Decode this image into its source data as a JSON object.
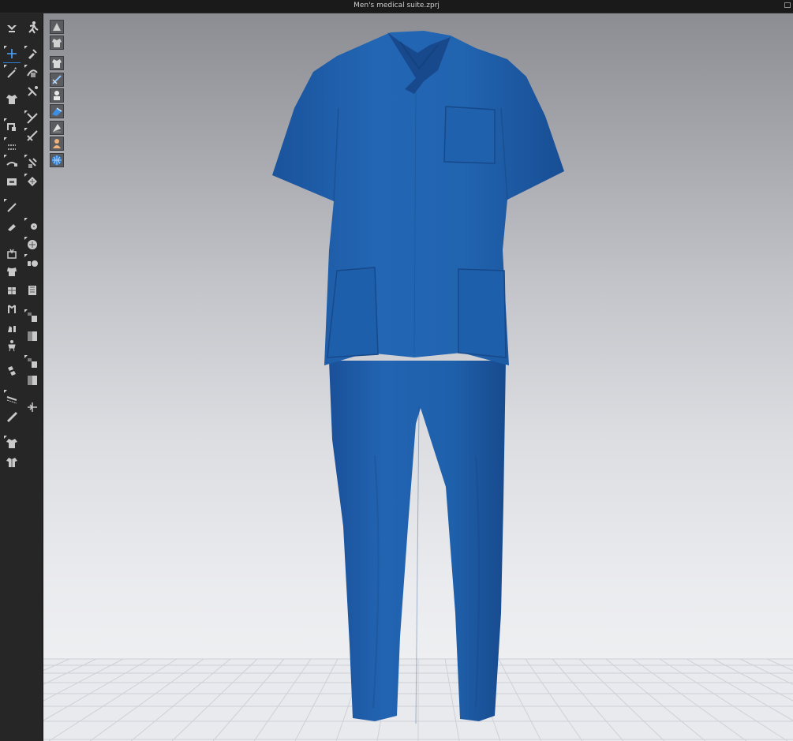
{
  "window": {
    "title": "Men's medical suite.zprj"
  },
  "colors": {
    "garment_blue": "#1d5eaa",
    "floor_grid": "#d7d8de",
    "toolbar_bg": "#262626"
  },
  "toolbar": {
    "tools": [
      {
        "name": "select-move-icon"
      },
      {
        "name": "simulation-icon"
      },
      {
        "name": "transform-pattern-icon"
      },
      {
        "name": "edit-pattern-icon"
      },
      {
        "name": "magic-wand-icon"
      },
      {
        "name": "edit-curvature-icon"
      },
      {
        "name": "garment-fit-icon"
      },
      {
        "name": "segment-sewing-icon"
      },
      {
        "name": "fold-arrangement-icon"
      },
      {
        "name": "free-sewing-icon"
      },
      {
        "name": "reset-2d-icon"
      },
      {
        "name": "edit-sewing-icon"
      },
      {
        "name": "arrangement-point-icon"
      },
      {
        "name": "tack-icon"
      },
      {
        "name": "texture-edit-icon"
      },
      {
        "name": "fabric-edit-icon"
      },
      {
        "name": "pin-icon"
      },
      {
        "name": "button-icon"
      },
      {
        "name": "brush-icon"
      },
      {
        "name": "lock-icon"
      },
      {
        "name": "measure-icon"
      },
      {
        "name": "zip-icon"
      },
      {
        "name": "shirt-front-icon"
      },
      {
        "name": "grid-pattern-icon"
      },
      {
        "name": "sleeve-icon"
      },
      {
        "name": "graphic-icon"
      },
      {
        "name": "puckering-icon"
      },
      {
        "name": "pattern-shape-icon"
      },
      {
        "name": "avatar-measure-icon"
      },
      {
        "name": "rectangle-icon"
      },
      {
        "name": "copy-pattern-icon"
      },
      {
        "name": "ruler-icon"
      },
      {
        "name": "line-draw-icon"
      },
      {
        "name": "split-icon"
      },
      {
        "name": "edit-line-icon"
      },
      {
        "name": "shirt-back-icon"
      },
      {
        "name": "shirt-side-icon"
      }
    ]
  },
  "viewport_tools": [
    {
      "name": "avatar-display-icon"
    },
    {
      "name": "garment-display-icon"
    },
    {
      "name": "texture-surface-icon"
    },
    {
      "name": "wireframe-icon"
    },
    {
      "name": "avatar-skin-icon"
    },
    {
      "name": "thick-surface-icon"
    },
    {
      "name": "mesh-view-icon"
    },
    {
      "name": "avatar-body-icon"
    },
    {
      "name": "globe-environment-icon"
    }
  ]
}
